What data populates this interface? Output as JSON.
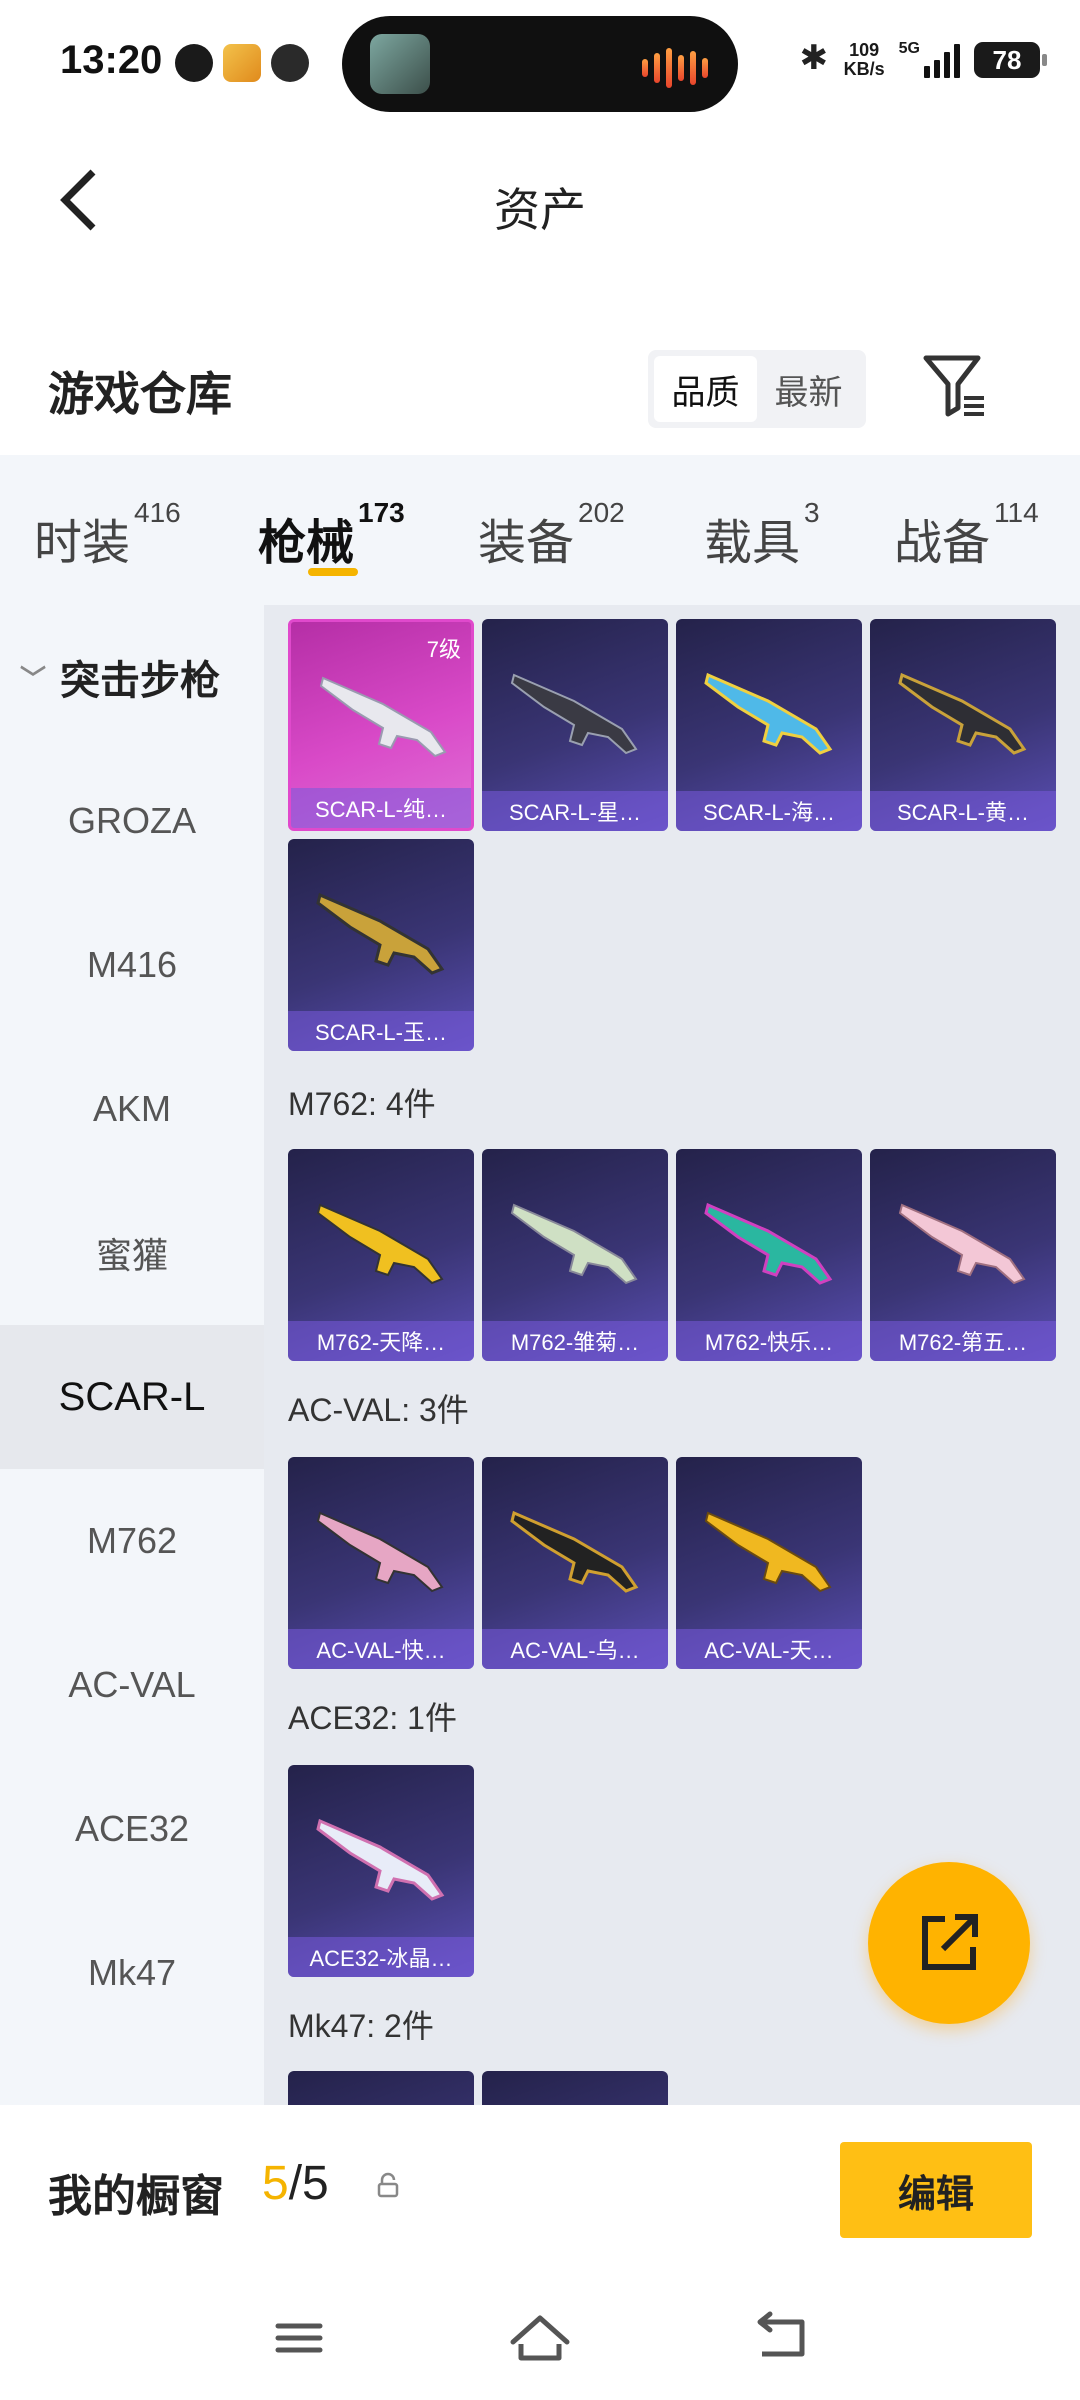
{
  "status": {
    "time": "13:20",
    "speed_value": "109",
    "speed_unit": "KB/s",
    "network": "5G",
    "battery": "78"
  },
  "header": {
    "title": "资产"
  },
  "warehouse": {
    "title": "游戏仓库",
    "sort_quality": "品质",
    "sort_newest": "最新"
  },
  "tabs": [
    {
      "label": "时装",
      "count": "416"
    },
    {
      "label": "枪械",
      "count": "173"
    },
    {
      "label": "装备",
      "count": "202"
    },
    {
      "label": "载具",
      "count": "3"
    },
    {
      "label": "战备",
      "count": "114"
    }
  ],
  "sidebar": {
    "group": "突击步枪",
    "items": [
      "GROZA",
      "M416",
      "AKM",
      "蜜獾",
      "SCAR-L",
      "M762",
      "AC-VAL",
      "ACE32",
      "Mk47"
    ]
  },
  "sections": {
    "scar": {
      "level_badge": "7级",
      "items": [
        "SCAR-L-纯…",
        "SCAR-L-星…",
        "SCAR-L-海…",
        "SCAR-L-黄…",
        "SCAR-L-玉…"
      ]
    },
    "m762": {
      "header": "M762: 4件",
      "items": [
        "M762-天降…",
        "M762-雏菊…",
        "M762-快乐…",
        "M762-第五…"
      ]
    },
    "acval": {
      "header": "AC-VAL: 3件",
      "items": [
        "AC-VAL-快…",
        "AC-VAL-乌…",
        "AC-VAL-天…"
      ]
    },
    "ace32": {
      "header": "ACE32: 1件",
      "items": [
        "ACE32-冰晶…"
      ]
    },
    "mk47": {
      "header": "Mk47: 2件"
    }
  },
  "showcase": {
    "title": "我的橱窗",
    "current": "5",
    "total": "/5",
    "edit_label": "编辑"
  },
  "colors": {
    "accent": "#ffb300",
    "tab_underline": "#f5b400",
    "card_purple": "#3a3575",
    "card_pink": "#d94ac8"
  }
}
